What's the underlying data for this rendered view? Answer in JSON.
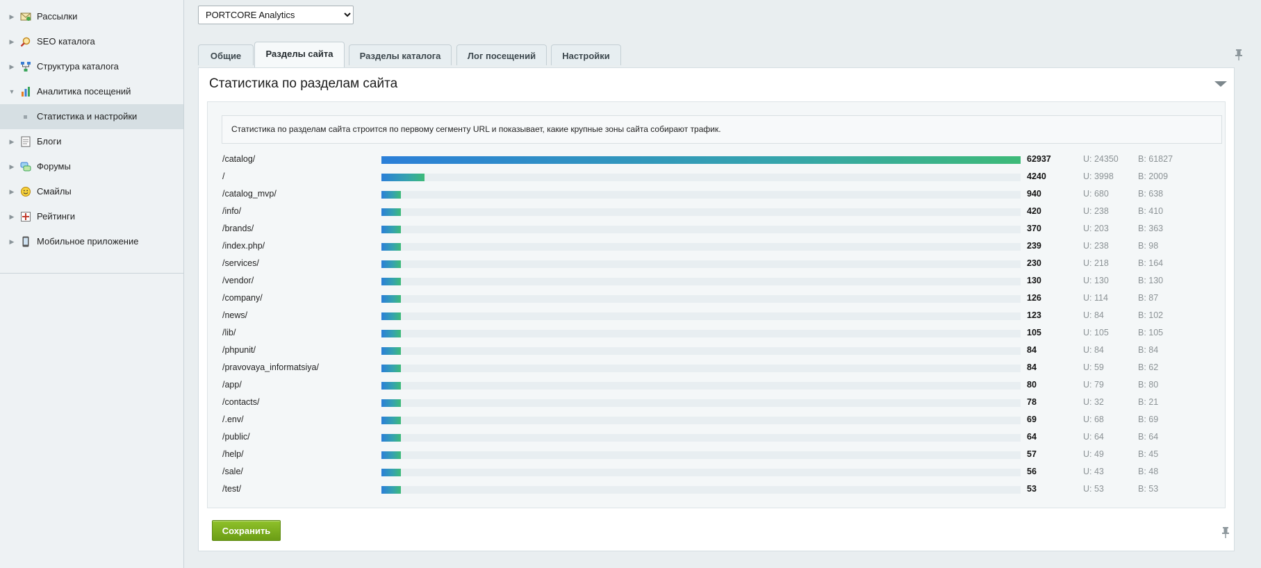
{
  "sidebar": {
    "items": [
      {
        "label": "Рассылки",
        "arrow": "▶",
        "icon": "mailing-icon"
      },
      {
        "label": "SEO каталога",
        "arrow": "▶",
        "icon": "seo-icon"
      },
      {
        "label": "Структура каталога",
        "arrow": "▶",
        "icon": "structure-icon"
      },
      {
        "label": "Аналитика посещений",
        "arrow": "▼",
        "icon": "analytics-icon"
      },
      {
        "label": "Статистика и настройки",
        "arrow": "",
        "icon": "bullet-icon"
      },
      {
        "label": "Блоги",
        "arrow": "▶",
        "icon": "blogs-icon"
      },
      {
        "label": "Форумы",
        "arrow": "▶",
        "icon": "forums-icon"
      },
      {
        "label": "Смайлы",
        "arrow": "▶",
        "icon": "smiley-icon"
      },
      {
        "label": "Рейтинги",
        "arrow": "▶",
        "icon": "ratings-icon"
      },
      {
        "label": "Мобильное приложение",
        "arrow": "▶",
        "icon": "mobile-icon"
      }
    ]
  },
  "site_select": {
    "value": "PORTCORE Analytics"
  },
  "tabs": [
    {
      "label": "Общие"
    },
    {
      "label": "Разделы сайта"
    },
    {
      "label": "Разделы каталога"
    },
    {
      "label": "Лог посещений"
    },
    {
      "label": "Настройки"
    }
  ],
  "panel": {
    "title": "Статистика по разделам сайта",
    "note": "Статистика по разделам сайта строится по первому сегменту URL и показывает, какие крупные зоны сайта собирают трафик."
  },
  "rows": [
    {
      "path": "/catalog/",
      "total": "62937",
      "u": "U: 24350",
      "b": "B: 61827",
      "share": 1.0
    },
    {
      "path": "/",
      "total": "4240",
      "u": "U: 3998",
      "b": "B: 2009",
      "share": 0.0674
    },
    {
      "path": "/catalog_mvp/",
      "total": "940",
      "u": "U: 680",
      "b": "B: 638",
      "share": 0.03
    },
    {
      "path": "/info/",
      "total": "420",
      "u": "U: 238",
      "b": "B: 410",
      "share": 0.03
    },
    {
      "path": "/brands/",
      "total": "370",
      "u": "U: 203",
      "b": "B: 363",
      "share": 0.03
    },
    {
      "path": "/index.php/",
      "total": "239",
      "u": "U: 238",
      "b": "B: 98",
      "share": 0.03
    },
    {
      "path": "/services/",
      "total": "230",
      "u": "U: 218",
      "b": "B: 164",
      "share": 0.03
    },
    {
      "path": "/vendor/",
      "total": "130",
      "u": "U: 130",
      "b": "B: 130",
      "share": 0.03
    },
    {
      "path": "/company/",
      "total": "126",
      "u": "U: 114",
      "b": "B: 87",
      "share": 0.03
    },
    {
      "path": "/news/",
      "total": "123",
      "u": "U: 84",
      "b": "B: 102",
      "share": 0.03
    },
    {
      "path": "/lib/",
      "total": "105",
      "u": "U: 105",
      "b": "B: 105",
      "share": 0.03
    },
    {
      "path": "/phpunit/",
      "total": "84",
      "u": "U: 84",
      "b": "B: 84",
      "share": 0.03
    },
    {
      "path": "/pravovaya_informatsiya/",
      "total": "84",
      "u": "U: 59",
      "b": "B: 62",
      "share": 0.03
    },
    {
      "path": "/app/",
      "total": "80",
      "u": "U: 79",
      "b": "B: 80",
      "share": 0.03
    },
    {
      "path": "/contacts/",
      "total": "78",
      "u": "U: 32",
      "b": "B: 21",
      "share": 0.03
    },
    {
      "path": "/.env/",
      "total": "69",
      "u": "U: 68",
      "b": "B: 69",
      "share": 0.03
    },
    {
      "path": "/public/",
      "total": "64",
      "u": "U: 64",
      "b": "B: 64",
      "share": 0.03
    },
    {
      "path": "/help/",
      "total": "57",
      "u": "U: 49",
      "b": "B: 45",
      "share": 0.03
    },
    {
      "path": "/sale/",
      "total": "56",
      "u": "U: 43",
      "b": "B: 48",
      "share": 0.03
    },
    {
      "path": "/test/",
      "total": "53",
      "u": "U: 53",
      "b": "B: 53",
      "share": 0.03
    }
  ],
  "save_button": {
    "label": "Сохранить"
  },
  "colors": {
    "accent_start": "#2b7fd8",
    "accent_end": "#3dba78",
    "save_green": "#7aae1e"
  }
}
